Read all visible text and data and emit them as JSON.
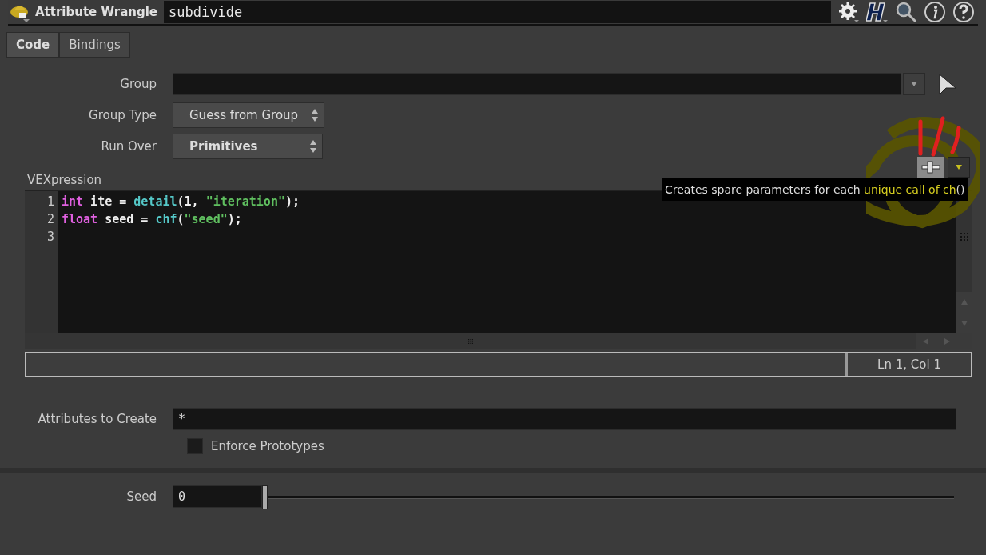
{
  "header": {
    "node_type": "Attribute Wrangle",
    "node_name": "subdivide"
  },
  "tabs": [
    {
      "label": "Code",
      "selected": true
    },
    {
      "label": "Bindings",
      "selected": false
    }
  ],
  "group": {
    "label": "Group"
  },
  "group_type": {
    "label": "Group Type",
    "value": "Guess from Group"
  },
  "run_over": {
    "label": "Run Over",
    "value": "Primitives"
  },
  "vexpression": {
    "label": "VEXpression",
    "lines": [
      {
        "number": "1",
        "tokens": [
          {
            "text": "int",
            "kind": "keyword"
          },
          {
            "text": " ite = ",
            "kind": "plain"
          },
          {
            "text": "detail",
            "kind": "function"
          },
          {
            "text": "(1, ",
            "kind": "plain"
          },
          {
            "text": "\"iteration\"",
            "kind": "string"
          },
          {
            "text": ");",
            "kind": "plain"
          }
        ]
      },
      {
        "number": "2",
        "tokens": [
          {
            "text": "float",
            "kind": "keyword"
          },
          {
            "text": " seed = ",
            "kind": "plain"
          },
          {
            "text": "chf",
            "kind": "function"
          },
          {
            "text": "(",
            "kind": "plain"
          },
          {
            "text": "\"seed\"",
            "kind": "string"
          },
          {
            "text": ");",
            "kind": "plain"
          }
        ]
      },
      {
        "number": "3"
      }
    ],
    "status": "Ln 1, Col 1"
  },
  "tooltip": [
    {
      "text": "Creates spare parameters for each ",
      "highlighted": false
    },
    {
      "text": "unique call of ch",
      "highlighted": true
    },
    {
      "text": "()",
      "highlighted": false
    }
  ],
  "attributes_to_create": {
    "label": "Attributes to Create",
    "value": "*"
  },
  "enforce_prototypes": {
    "label": "Enforce Prototypes",
    "checked": false
  },
  "seed": {
    "label": "Seed",
    "value": "0",
    "level": 0
  }
}
